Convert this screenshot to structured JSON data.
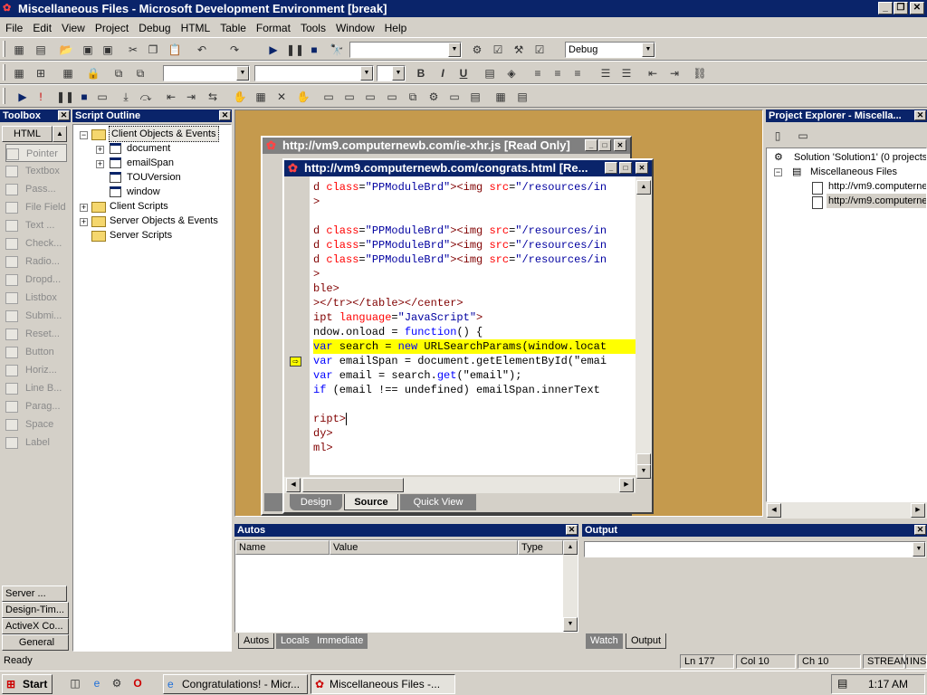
{
  "window": {
    "title": "Miscellaneous Files - Microsoft Development Environment [break]"
  },
  "menu": [
    "File",
    "Edit",
    "View",
    "Project",
    "Debug",
    "HTML",
    "Table",
    "Format",
    "Tools",
    "Window",
    "Help"
  ],
  "toolbar": {
    "config_combo": "Debug"
  },
  "toolbox": {
    "title": "Toolbox",
    "tab": "HTML",
    "items": [
      "Pointer",
      "Textbox",
      "Pass...",
      "File Field",
      "Text ...",
      "Check...",
      "Radio...",
      "Dropd...",
      "Listbox",
      "Submi...",
      "Reset...",
      "Button",
      "Horiz...",
      "Line B...",
      "Parag...",
      "Space",
      "Label"
    ],
    "bottom_tabs": [
      "Server ...",
      "Design-Tim...",
      "ActiveX Co...",
      "General"
    ]
  },
  "outline": {
    "title": "Script Outline",
    "root": "Client Objects & Events",
    "children": [
      "document",
      "emailSpan",
      "TOUVersion",
      "window"
    ],
    "others": [
      "Client Scripts",
      "Server Objects & Events",
      "Server Scripts"
    ]
  },
  "editor_back": {
    "title": "http://vm9.computernewb.com/ie-xhr.js [Read Only]"
  },
  "editor": {
    "title": "http://vm9.computernewb.com/congrats.html [Re...",
    "tabs": [
      "Design",
      "Source",
      "Quick View"
    ],
    "lines": [
      [
        [
          "tg",
          "d "
        ],
        [
          "at",
          "class"
        ],
        [
          "bk",
          "="
        ],
        [
          "st",
          "\"PPModuleBrd\""
        ],
        [
          "tg",
          "><img "
        ],
        [
          "at",
          "src"
        ],
        [
          "bk",
          "="
        ],
        [
          "st",
          "\"/resources/in"
        ]
      ],
      [
        [
          "tg",
          ">"
        ]
      ],
      [],
      [
        [
          "tg",
          "d "
        ],
        [
          "at",
          "class"
        ],
        [
          "bk",
          "="
        ],
        [
          "st",
          "\"PPModuleBrd\""
        ],
        [
          "tg",
          "><img "
        ],
        [
          "at",
          "src"
        ],
        [
          "bk",
          "="
        ],
        [
          "st",
          "\"/resources/in"
        ]
      ],
      [
        [
          "tg",
          "d "
        ],
        [
          "at",
          "class"
        ],
        [
          "bk",
          "="
        ],
        [
          "st",
          "\"PPModuleBrd\""
        ],
        [
          "tg",
          "><img "
        ],
        [
          "at",
          "src"
        ],
        [
          "bk",
          "="
        ],
        [
          "st",
          "\"/resources/in"
        ]
      ],
      [
        [
          "tg",
          "d "
        ],
        [
          "at",
          "class"
        ],
        [
          "bk",
          "="
        ],
        [
          "st",
          "\"PPModuleBrd\""
        ],
        [
          "tg",
          "><img "
        ],
        [
          "at",
          "src"
        ],
        [
          "bk",
          "="
        ],
        [
          "st",
          "\"/resources/in"
        ]
      ],
      [
        [
          "tg",
          ">"
        ]
      ],
      [
        [
          "tg",
          "ble>"
        ]
      ],
      [
        [
          "tg",
          "></tr></table></center>"
        ]
      ],
      [
        [
          "tg",
          "ipt "
        ],
        [
          "at",
          "language"
        ],
        [
          "bk",
          "="
        ],
        [
          "st",
          "\"JavaScript\""
        ],
        [
          "tg",
          ">"
        ]
      ],
      [
        [
          "bk",
          "ndow.onload = "
        ],
        [
          "kw",
          "function"
        ],
        [
          "bk",
          "() {"
        ]
      ],
      [
        [
          "kw",
          "var"
        ],
        [
          "bk",
          " search = "
        ],
        [
          "kw",
          "new"
        ],
        [
          "bk",
          " URLSearchParams(window.locat"
        ]
      ],
      [
        [
          "kw",
          "var"
        ],
        [
          "bk",
          " emailSpan = document.getElementById(\"emai"
        ]
      ],
      [
        [
          "kw",
          "var"
        ],
        [
          "bk",
          " email = search."
        ],
        [
          "kw",
          "get"
        ],
        [
          "bk",
          "(\"email\");"
        ]
      ],
      [
        [
          "kw",
          "if"
        ],
        [
          "bk",
          " (email !== undefined) emailSpan.innerText "
        ]
      ],
      [],
      [
        [
          "tg",
          "ript>"
        ]
      ],
      [
        [
          "tg",
          "dy>"
        ]
      ],
      [
        [
          "tg",
          "ml>"
        ]
      ]
    ]
  },
  "project_explorer": {
    "title": "Project Explorer - Miscella...",
    "solution": "Solution 'Solution1' (0 projects)",
    "folder": "Miscellaneous Files",
    "files": [
      "http://vm9.computerne",
      "http://vm9.computerne"
    ]
  },
  "autos": {
    "title": "Autos",
    "columns": [
      "Name",
      "Value",
      "Type"
    ],
    "tabs": [
      "Autos",
      "Locals",
      "Immediate"
    ]
  },
  "output": {
    "title": "Output",
    "tabs": [
      "Watch",
      "Output"
    ]
  },
  "status": {
    "text": "Ready",
    "ln": "Ln 177",
    "col": "Col 10",
    "ch": "Ch 10",
    "mode1": "STREAM",
    "mode2": "INS"
  },
  "taskbar": {
    "start": "Start",
    "tasks": [
      "Congratulations! - Micr...",
      "Miscellaneous Files -..."
    ],
    "clock": "1:17 AM"
  }
}
